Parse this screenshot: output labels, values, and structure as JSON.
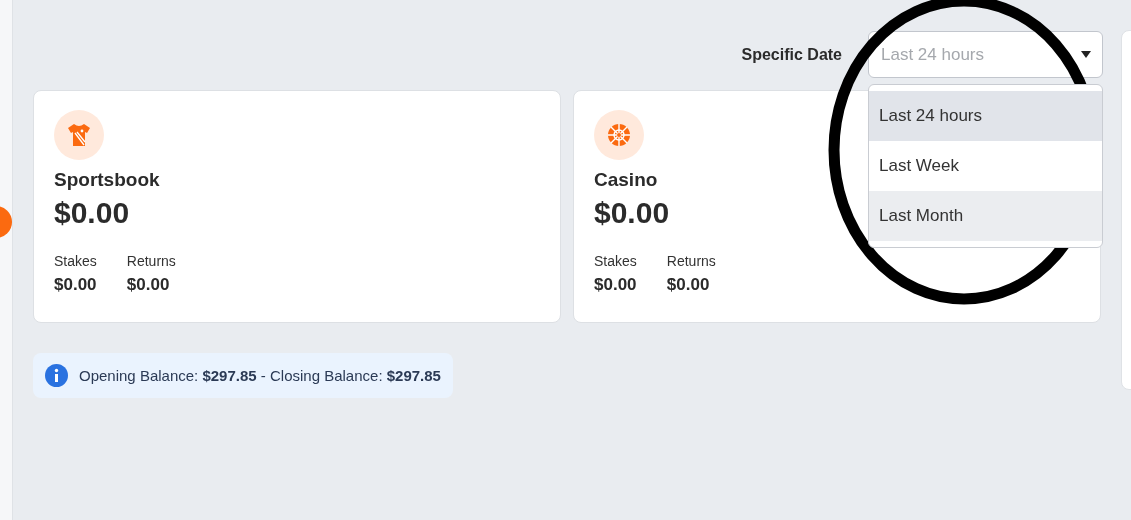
{
  "filter": {
    "label": "Specific Date",
    "select": {
      "placeholder": "Last 24 hours",
      "expanded": true
    },
    "options": [
      {
        "label": "Last 24 hours",
        "selected": true,
        "hovered": false
      },
      {
        "label": "Last Week",
        "selected": false,
        "hovered": false
      },
      {
        "label": "Last Month",
        "selected": false,
        "hovered": true
      }
    ]
  },
  "cards": [
    {
      "kind": "sportsbook",
      "title": "Sportsbook",
      "amount": "$0.00",
      "stats": [
        {
          "label": "Stakes",
          "value": "$0.00"
        },
        {
          "label": "Returns",
          "value": "$0.00"
        }
      ]
    },
    {
      "kind": "casino",
      "title": "Casino",
      "amount": "$0.00",
      "stats": [
        {
          "label": "Stakes",
          "value": "$0.00"
        },
        {
          "label": "Returns",
          "value": "$0.00"
        }
      ]
    }
  ],
  "balance_note": "Opening Balance: **$297.85** - Closing Balance: **$297.85**",
  "annotation": {
    "kind": "ellipse"
  }
}
